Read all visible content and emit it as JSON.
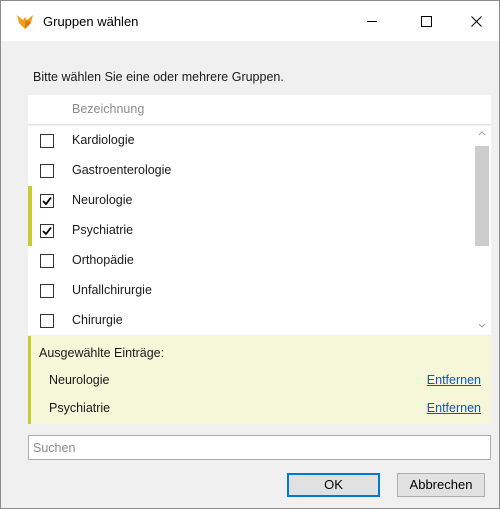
{
  "window": {
    "title": "Gruppen wählen",
    "minimize_icon": "minimize-icon",
    "maximize_icon": "maximize-icon",
    "close_icon": "close-icon",
    "app_icon": "fox-logo-icon",
    "accent_color": "#c7cc2e"
  },
  "instruction": "Bitte wählen Sie eine oder mehrere Gruppen.",
  "list": {
    "column_header": "Bezeichnung",
    "items": [
      {
        "label": "Kardiologie",
        "checked": false
      },
      {
        "label": "Gastroenterologie",
        "checked": false
      },
      {
        "label": "Neurologie",
        "checked": true
      },
      {
        "label": "Psychiatrie",
        "checked": true
      },
      {
        "label": "Orthopädie",
        "checked": false
      },
      {
        "label": "Unfallchirurgie",
        "checked": false
      },
      {
        "label": "Chirurgie",
        "checked": false
      }
    ]
  },
  "selected": {
    "title": "Ausgewählte Einträge:",
    "remove_label": "Entfernen",
    "items": [
      "Neurologie",
      "Psychiatrie"
    ]
  },
  "search": {
    "placeholder": "Suchen",
    "value": ""
  },
  "buttons": {
    "ok_label": "OK",
    "cancel_label": "Abbrechen"
  }
}
